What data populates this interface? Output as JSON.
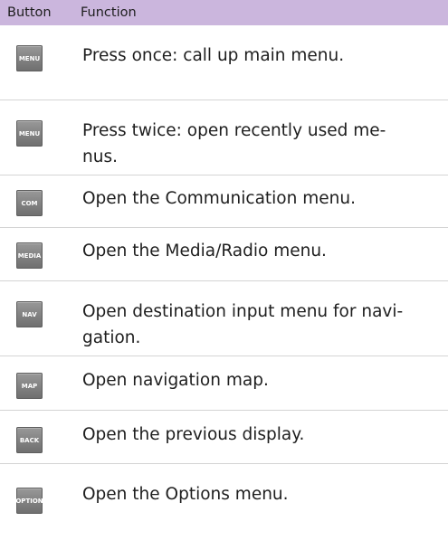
{
  "table": {
    "header": {
      "button": "Button",
      "function": "Function"
    },
    "rows": [
      {
        "key": "MENU",
        "text": "Press once: call up main menu."
      },
      {
        "key": "MENU",
        "text": "Press twice: open recently used me-\nnus."
      },
      {
        "key": "COM",
        "text": "Open the Communication menu."
      },
      {
        "key": "MEDIA",
        "text": "Open the Media/Radio menu."
      },
      {
        "key": "NAV",
        "text": "Open destination input menu for navi-\ngation."
      },
      {
        "key": "MAP",
        "text": "Open navigation map."
      },
      {
        "key": "BACK",
        "text": "Open the previous display."
      },
      {
        "key": "OPTION",
        "text": "Open the Options menu."
      }
    ]
  }
}
